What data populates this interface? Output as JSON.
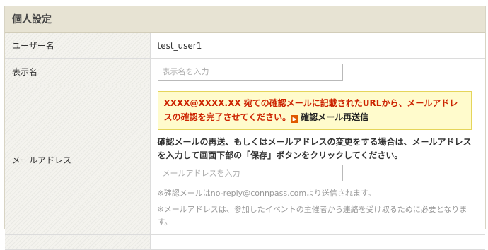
{
  "panel": {
    "title": "個人設定"
  },
  "rows": {
    "username": {
      "label": "ユーザー名",
      "value": "test_user1"
    },
    "display_name": {
      "label": "表示名",
      "placeholder": "表示名を入力"
    },
    "email": {
      "label": "メールアドレス",
      "notice_text": "XXXX@XXXX.XX 宛ての確認メールに記載されたURLから、メールアドレスの確認を完了させてください。",
      "resend_link": "確認メール再送信",
      "instruction": "確認メールの再送、もしくはメールアドレスの変更をする場合は、メールアドレスを入力して画面下部の「保存」ボタンをクリックしてください。",
      "placeholder": "メールアドレスを入力",
      "note_sender": "※確認メールはno-reply@connpass.comより送信されます。",
      "note_usage": "※メールアドレスは、参加したイベントの主催者から連絡を受け取るために必要となります。"
    }
  },
  "colors": {
    "header_bg": "#e7e3d3",
    "notice_bg": "#fffbcc",
    "notice_border": "#e5d55a",
    "notice_text": "#cc2200",
    "link_icon": "#e05a00"
  },
  "icons": {
    "resend_link": "arrow-right-icon"
  }
}
